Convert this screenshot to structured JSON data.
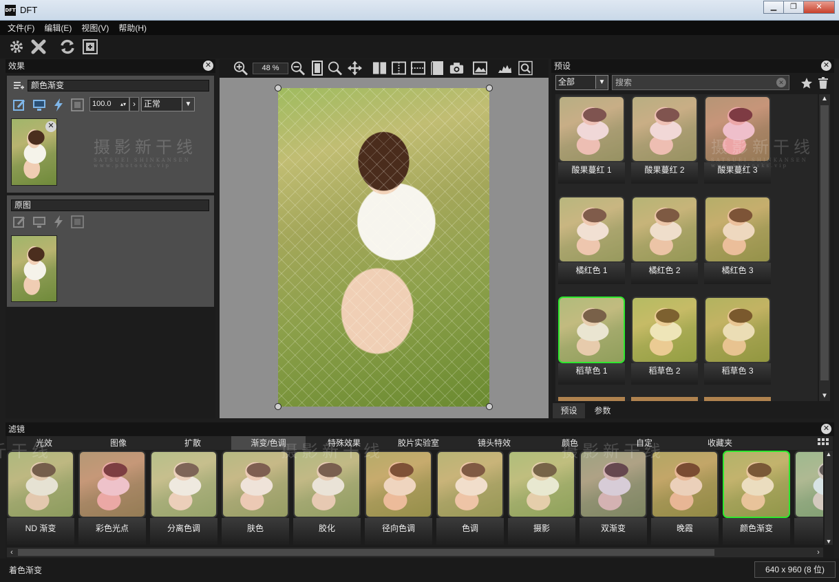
{
  "window": {
    "title": "DFT",
    "app_icon_text": "DFT",
    "min": "▁",
    "max": "❐",
    "close": "✕"
  },
  "menu": [
    "文件(F)",
    "编辑(E)",
    "视图(V)",
    "帮助(H)"
  ],
  "effects_panel": {
    "title": "效果",
    "effect_name": "颜色渐变",
    "opacity": "100.0",
    "blend_mode": "正常",
    "original_label": "原图"
  },
  "watermark": {
    "title": "摄影新干线",
    "romaji": "SATSUEI SHINKANSEN",
    "url": "www.photosks.vip"
  },
  "canvas": {
    "zoom": "48 %"
  },
  "presets_panel": {
    "title": "预设",
    "filter": "全部",
    "search_placeholder": "搜索",
    "items": [
      {
        "label": "酸果蔓红 1",
        "tint": "#e8a3b4",
        "selected": false
      },
      {
        "label": "酸果蔓红 2",
        "tint": "#eaa2b0",
        "selected": false
      },
      {
        "label": "酸果蔓红 3",
        "tint": "#e4588e",
        "selected": false
      },
      {
        "label": "橘红色 1",
        "tint": "#e9b9a4",
        "selected": false
      },
      {
        "label": "橘红色 2",
        "tint": "#e4b38c",
        "selected": false
      },
      {
        "label": "橘红色 3",
        "tint": "#e0a36a",
        "selected": false
      },
      {
        "label": "稻草色 1",
        "tint": "#d6c9a0",
        "selected": true
      },
      {
        "label": "稻草色 2",
        "tint": "#e0c855",
        "selected": false
      },
      {
        "label": "稻草色 3",
        "tint": "#d9b04a",
        "selected": false
      }
    ],
    "tabs": [
      "预设",
      "参数"
    ]
  },
  "filters": {
    "title": "滤镜",
    "categories": [
      "光效",
      "图像",
      "扩散",
      "渐变/色调",
      "特殊效果",
      "胶片实验室",
      "镜头特效",
      "颜色",
      "自定",
      "收藏夹"
    ],
    "active_category": "渐变/色调",
    "items": [
      {
        "label": "ND 渐变",
        "tint": "#c9c0a4",
        "selected": false
      },
      {
        "label": "彩色光点",
        "tint": "#e0608a",
        "selected": false
      },
      {
        "label": "分离色调",
        "tint": "#e4d4c8",
        "selected": false
      },
      {
        "label": "肤色",
        "tint": "#e5c4b6",
        "selected": false
      },
      {
        "label": "胶化",
        "tint": "#d6c2b0",
        "selected": false
      },
      {
        "label": "径向色调",
        "tint": "#e59a68",
        "selected": false
      },
      {
        "label": "色调",
        "tint": "#e9b48d",
        "selected": false
      },
      {
        "label": "摄影",
        "tint": "#cfd39d",
        "selected": false
      },
      {
        "label": "双渐变",
        "tint": "#9b7fb0",
        "selected": false
      },
      {
        "label": "晚霞",
        "tint": "#d88a5a",
        "selected": false
      },
      {
        "label": "颜色渐变",
        "tint": "#d8b06a",
        "selected": true
      },
      {
        "label": "着",
        "tint": "#9cc4d8",
        "selected": false
      }
    ]
  },
  "status": {
    "left": "着色渐变",
    "right": "640 x 960 (8 位)"
  },
  "colors": {
    "accent_selected": "#2ee82e"
  }
}
